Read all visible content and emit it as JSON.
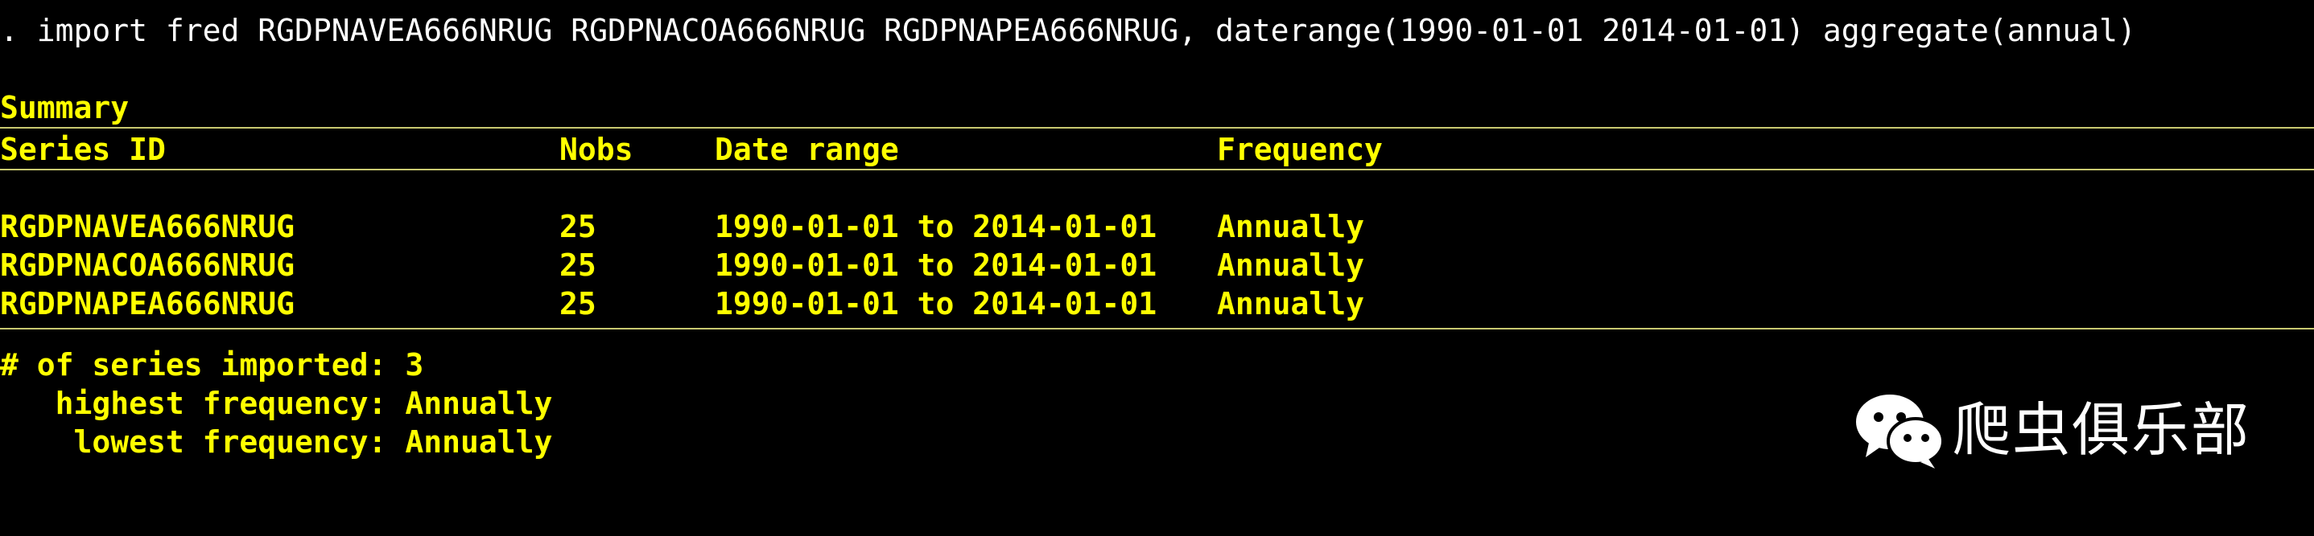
{
  "command": ". import fred RGDPNAVEA666NRUG RGDPNACOA666NRUG RGDPNAPEA666NRUG, daterange(1990-01-01 2014-01-01) aggregate(annual)",
  "summary_heading": "Summary",
  "table": {
    "headers": [
      "Series ID",
      "Nobs",
      "Date range",
      "Frequency"
    ],
    "rows": [
      {
        "series_id": "RGDPNAVEA666NRUG",
        "nobs": "25",
        "date_range": "1990-01-01 to 2014-01-01",
        "frequency": "Annually"
      },
      {
        "series_id": "RGDPNACOA666NRUG",
        "nobs": "25",
        "date_range": "1990-01-01 to 2014-01-01",
        "frequency": "Annually"
      },
      {
        "series_id": "RGDPNAPEA666NRUG",
        "nobs": "25",
        "date_range": "1990-01-01 to 2014-01-01",
        "frequency": "Annually"
      }
    ]
  },
  "footer": {
    "series_imported": "# of series imported: 3",
    "highest": "   highest frequency: Annually",
    "lowest": "    lowest frequency: Annually"
  },
  "watermark": {
    "text": "爬虫俱乐部",
    "icon": "wechat-icon"
  },
  "colors": {
    "background": "#000000",
    "command": "#ffffff",
    "output": "#ffff00",
    "rule": "#c8c870"
  }
}
